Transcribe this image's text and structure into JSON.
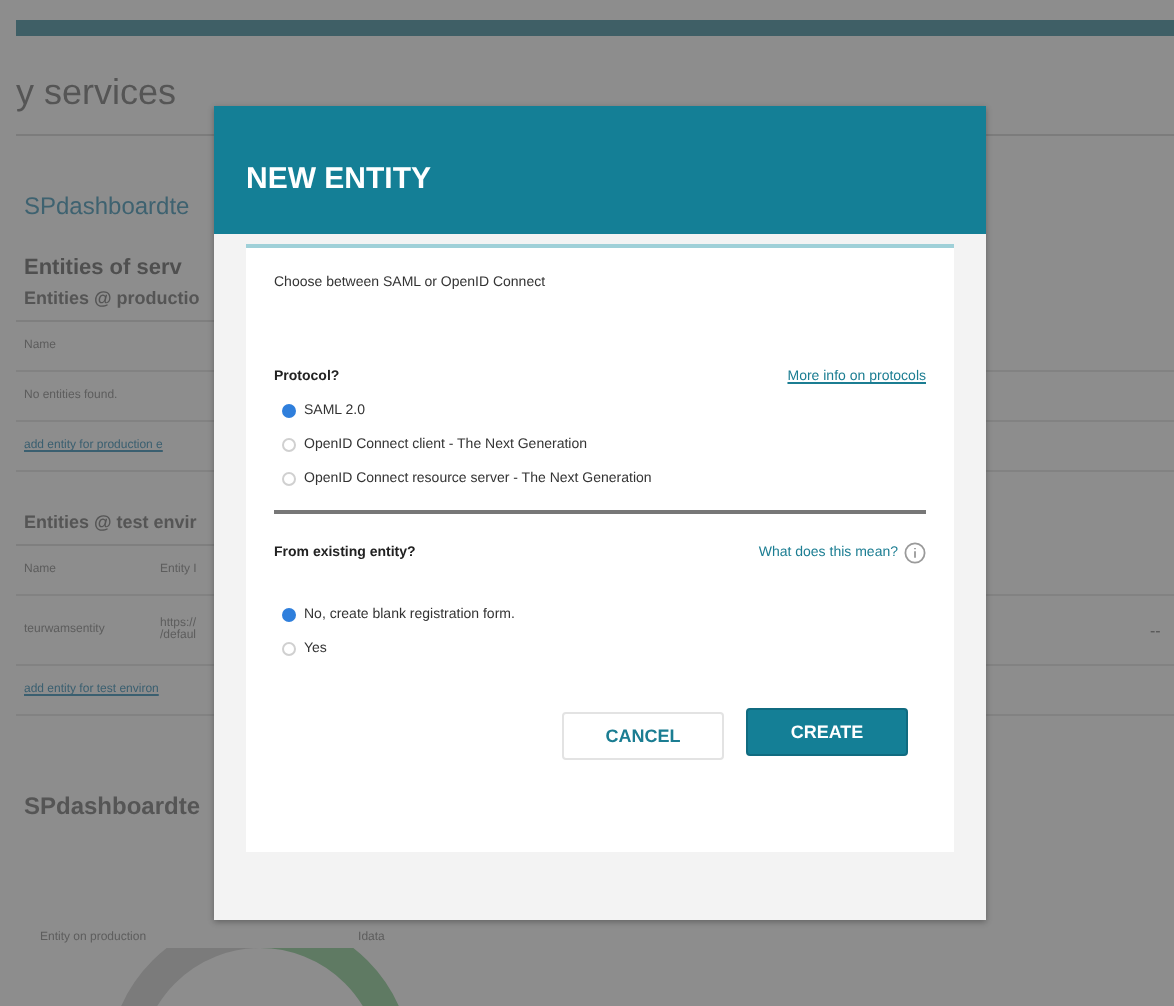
{
  "page": {
    "heading": "y services",
    "service_name": "SPdashboardte",
    "entities_heading": "Entities of serv",
    "production": {
      "heading": "Entities @ productio",
      "columns": [
        "Name"
      ],
      "empty_text": "No entities found.",
      "add_link": "add entity for production e"
    },
    "test": {
      "heading": "Entities @ test envir",
      "columns": [
        "Name",
        "Entity I"
      ],
      "rows": [
        {
          "cells": [
            "teurwamsentity",
            "https://\n/defaul"
          ],
          "action": "--"
        }
      ],
      "add_link": "add entity for test environ"
    },
    "stats": {
      "title": "SPdashboardte",
      "labels": [
        "Entity on production",
        "Idata"
      ]
    }
  },
  "dialog": {
    "title": "NEW ENTITY",
    "intro": "Choose between SAML or OpenID Connect",
    "groups": [
      {
        "label": "Protocol?",
        "help_link": "More info on protocols",
        "help_icon": false,
        "options": [
          {
            "label": "SAML 2.0",
            "selected": true
          },
          {
            "label": "OpenID Connect client - The Next Generation",
            "selected": false
          },
          {
            "label": "OpenID Connect resource server - The Next Generation",
            "selected": false
          }
        ]
      },
      {
        "label": "From existing entity?",
        "help_link": "What does this mean?",
        "help_icon": true,
        "options": [
          {
            "label": "No, create blank registration form.",
            "selected": true
          },
          {
            "label": "Yes",
            "selected": false
          }
        ]
      }
    ],
    "buttons": [
      {
        "label": "CANCEL",
        "kind": "secondary"
      },
      {
        "label": "CREATE",
        "kind": "primary"
      }
    ]
  }
}
